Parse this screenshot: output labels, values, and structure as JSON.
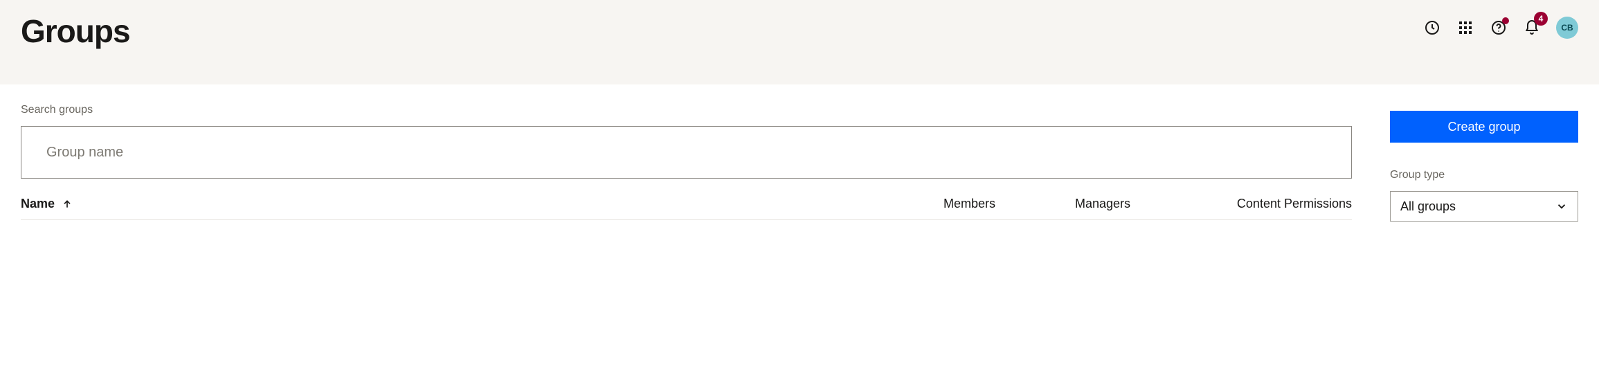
{
  "header": {
    "title": "Groups",
    "notification_count": "4",
    "avatar_initials": "CB"
  },
  "search": {
    "label": "Search groups",
    "placeholder": "Group name"
  },
  "actions": {
    "create_label": "Create group"
  },
  "filter": {
    "label": "Group type",
    "selected": "All groups"
  },
  "table": {
    "columns": {
      "name": "Name",
      "members": "Members",
      "managers": "Managers",
      "permissions": "Content Permissions"
    }
  }
}
